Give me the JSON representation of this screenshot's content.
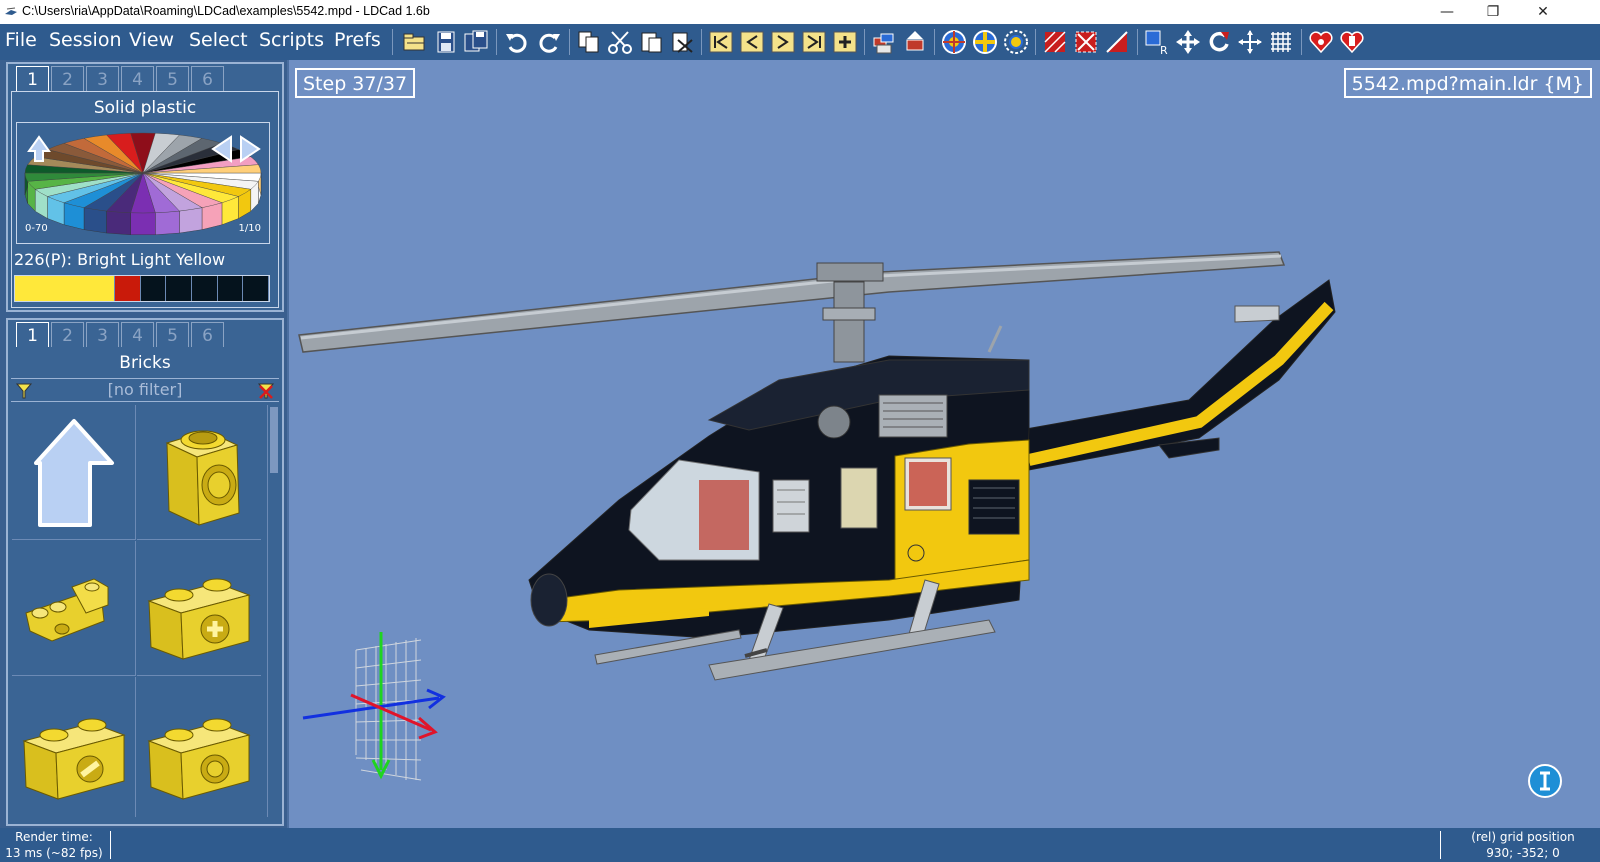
{
  "window": {
    "title": "C:\\Users\\ria\\AppData\\Roaming\\LDCad\\examples\\5542.mpd - LDCad 1.6b",
    "minimize": "—",
    "restore": "❐",
    "close": "✕"
  },
  "menu": {
    "items": [
      "File",
      "Session",
      "View",
      "Select",
      "Scripts",
      "Prefs"
    ]
  },
  "color_panel": {
    "tabs": [
      "1",
      "2",
      "3",
      "4",
      "5",
      "6"
    ],
    "active_tab": "1",
    "title": "Solid plastic",
    "range_label": "0-70",
    "page_label": "1/10",
    "selected_color": "226(P): Bright Light Yellow",
    "recent_swatches": [
      "#ffe83a",
      "#ffe83a",
      "#ffe83a",
      "#ffe83a",
      "#c91a0a",
      "#05131d",
      "#05131d",
      "#05131d",
      "#05131d",
      "#05131d"
    ]
  },
  "parts_panel": {
    "tabs": [
      "1",
      "2",
      "3",
      "4",
      "5",
      "6"
    ],
    "active_tab": "1",
    "title": "Bricks",
    "filter": "[no filter]",
    "items": [
      "group-up-arrow",
      "technic-brick-1x1-with-hole",
      "technic-liftarm-bent",
      "technic-brick-1x2-with-axle-hole",
      "technic-brick-1x2-with-pin",
      "technic-brick-1x2-with-hole"
    ]
  },
  "viewport": {
    "step": "Step 37/37",
    "model": "5542.mpd?main.ldr {M}"
  },
  "status": {
    "render_label": "Render time:",
    "render_value": "13 ms (~82 fps)",
    "grid_label": "(rel) grid position",
    "grid_value": "930; -352; 0"
  },
  "colors": {
    "menubar": "#2f5b8e",
    "viewport_bg": "#6f8fc3",
    "lego_yellow": "#f2c80f",
    "lego_black": "#0e1420"
  }
}
